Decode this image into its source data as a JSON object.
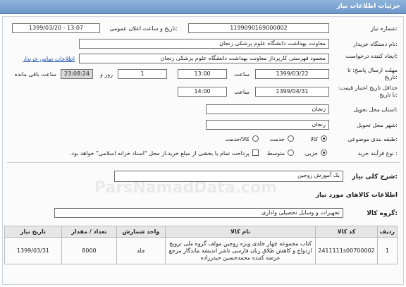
{
  "header": {
    "title": "جزئیات اطلاعات نیاز"
  },
  "fields": {
    "need_number_label": "شماره نیاز:",
    "need_number": "1199090169000002",
    "announce_label": "تاریخ و ساعت اعلان عمومی:",
    "announce_value": "1399/03/20 - 13:07",
    "buyer_label": "نام دستگاه خریدار:",
    "buyer_value": "معاونت بهداشت دانشگاه علوم پزشکی زنجان",
    "creator_label": "ایجاد کننده درخواست:",
    "creator_value": "محمود فهرستی کارپرداز معاونت بهداشت دانشگاه علوم پزشکی زنجان",
    "contact_link": "اطلاعات تماس خریدار",
    "reply_deadline_label": "مهلت ارسال پاسخ: تا تاریخ:",
    "reply_date": "1399/03/22",
    "time_label": "ساعت",
    "reply_time": "13:00",
    "days_value": "1",
    "days_label": "روز و",
    "remaining_time": "23:08:24",
    "remaining_label": "ساعت باقی مانده",
    "validity_label": "حداقل تاریخ اعتبار قیمت: تا تاریخ:",
    "validity_date": "1399/04/31",
    "validity_time": "14:00",
    "province_label": "استان محل تحویل:",
    "province_value": "زنجان",
    "city_label": "شهر محل تحویل:",
    "city_value": "زنجان",
    "category_label": "طبقه بندی موضوعی:",
    "category_options": [
      "کالا",
      "خدمت",
      "کالا/خدمت"
    ],
    "process_label": "نوع فرآیند خرید :",
    "process_options": [
      "جزیی",
      "متوسط"
    ],
    "payment_note": "پرداخت تمام یا بخشی از مبلغ خرید،از محل \"اسناد خزانه اسلامی\" خواهد بود.",
    "summary_label": "شرح کلی نیاز:",
    "summary_value": "یک آموزش زوجین",
    "goods_info_title": "اطلاعات کالاهای مورد نیاز",
    "goods_group_label": "گروه کالا:",
    "goods_group_value": "تجهیزات و وسایل تحصیلی واداری"
  },
  "watermark": "ParsNamadData.com",
  "table": {
    "headers": [
      "ردیف",
      "کد کالا",
      "نام کالا",
      "واحد شمارش",
      "تعداد / مقدار",
      "تاریخ نیاز"
    ],
    "rows": [
      {
        "index": "1",
        "code": "2411111s00700002",
        "name": "کتاب مجموعه چهار جلدی ویژه زوجین مولف گروه ملی ترویج ازدواج و کاهش طلاق زبان فارسی ناشر اندیشه ماندگار مرجع عرضه کننده محمدحسین حیدرزاده",
        "unit": "جلد",
        "qty": "8000",
        "date": "1399/03/31"
      }
    ]
  }
}
